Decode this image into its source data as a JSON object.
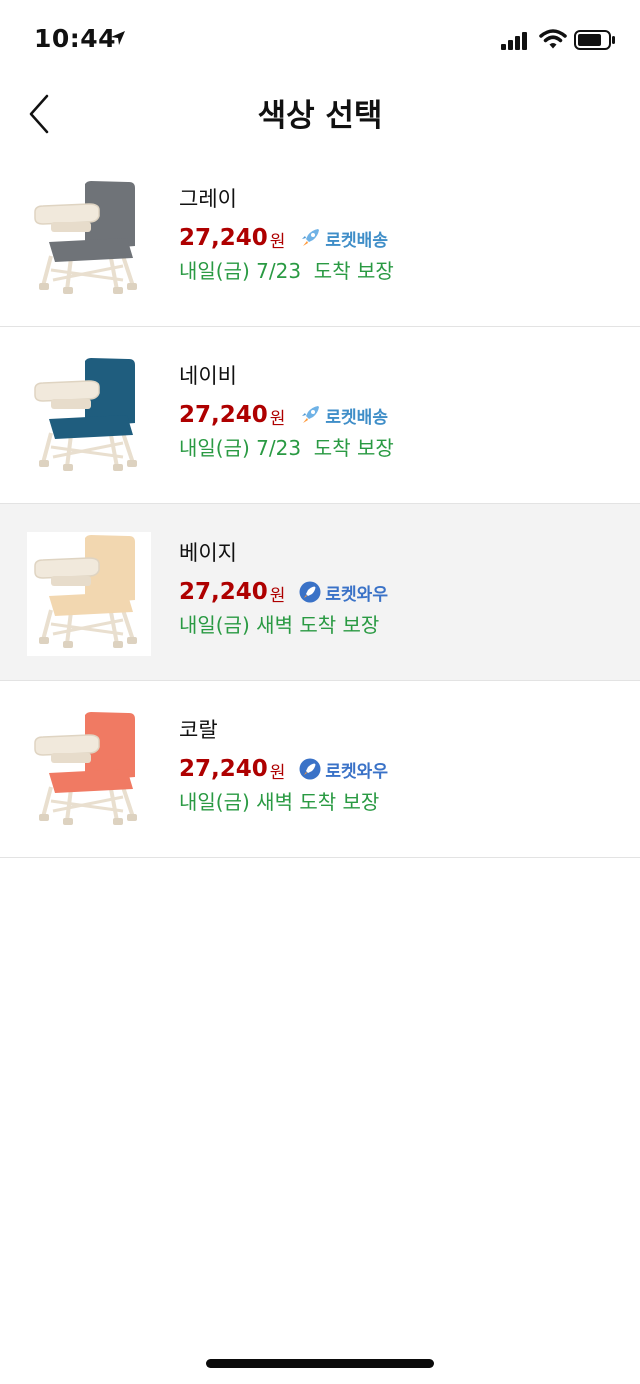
{
  "status_bar": {
    "time": "10:44"
  },
  "nav": {
    "title": "색상 선택"
  },
  "colors": {
    "price": "#ae0000",
    "delivery": "#2a9a43",
    "rocket_blue": "#3f8ec8",
    "selected_bg": "#f3f3f3"
  },
  "items": [
    {
      "name": "그레이",
      "price": "27,240",
      "currency": "원",
      "badge": "로켓배송",
      "badge_type": "rocket",
      "delivery": "내일(금) 7/23  도착 보장",
      "seat_color": "#6f7378",
      "selected": false
    },
    {
      "name": "네이비",
      "price": "27,240",
      "currency": "원",
      "badge": "로켓배송",
      "badge_type": "rocket",
      "delivery": "내일(금) 7/23  도착 보장",
      "seat_color": "#1f5d7e",
      "selected": false
    },
    {
      "name": "베이지",
      "price": "27,240",
      "currency": "원",
      "badge": "로켓와우",
      "badge_type": "wow",
      "delivery": "내일(금) 새벽 도착 보장",
      "seat_color": "#f2d7b0",
      "selected": true
    },
    {
      "name": "코랄",
      "price": "27,240",
      "currency": "원",
      "badge": "로켓와우",
      "badge_type": "wow",
      "delivery": "내일(금) 새벽 도착 보장",
      "seat_color": "#f07a63",
      "selected": false
    }
  ]
}
